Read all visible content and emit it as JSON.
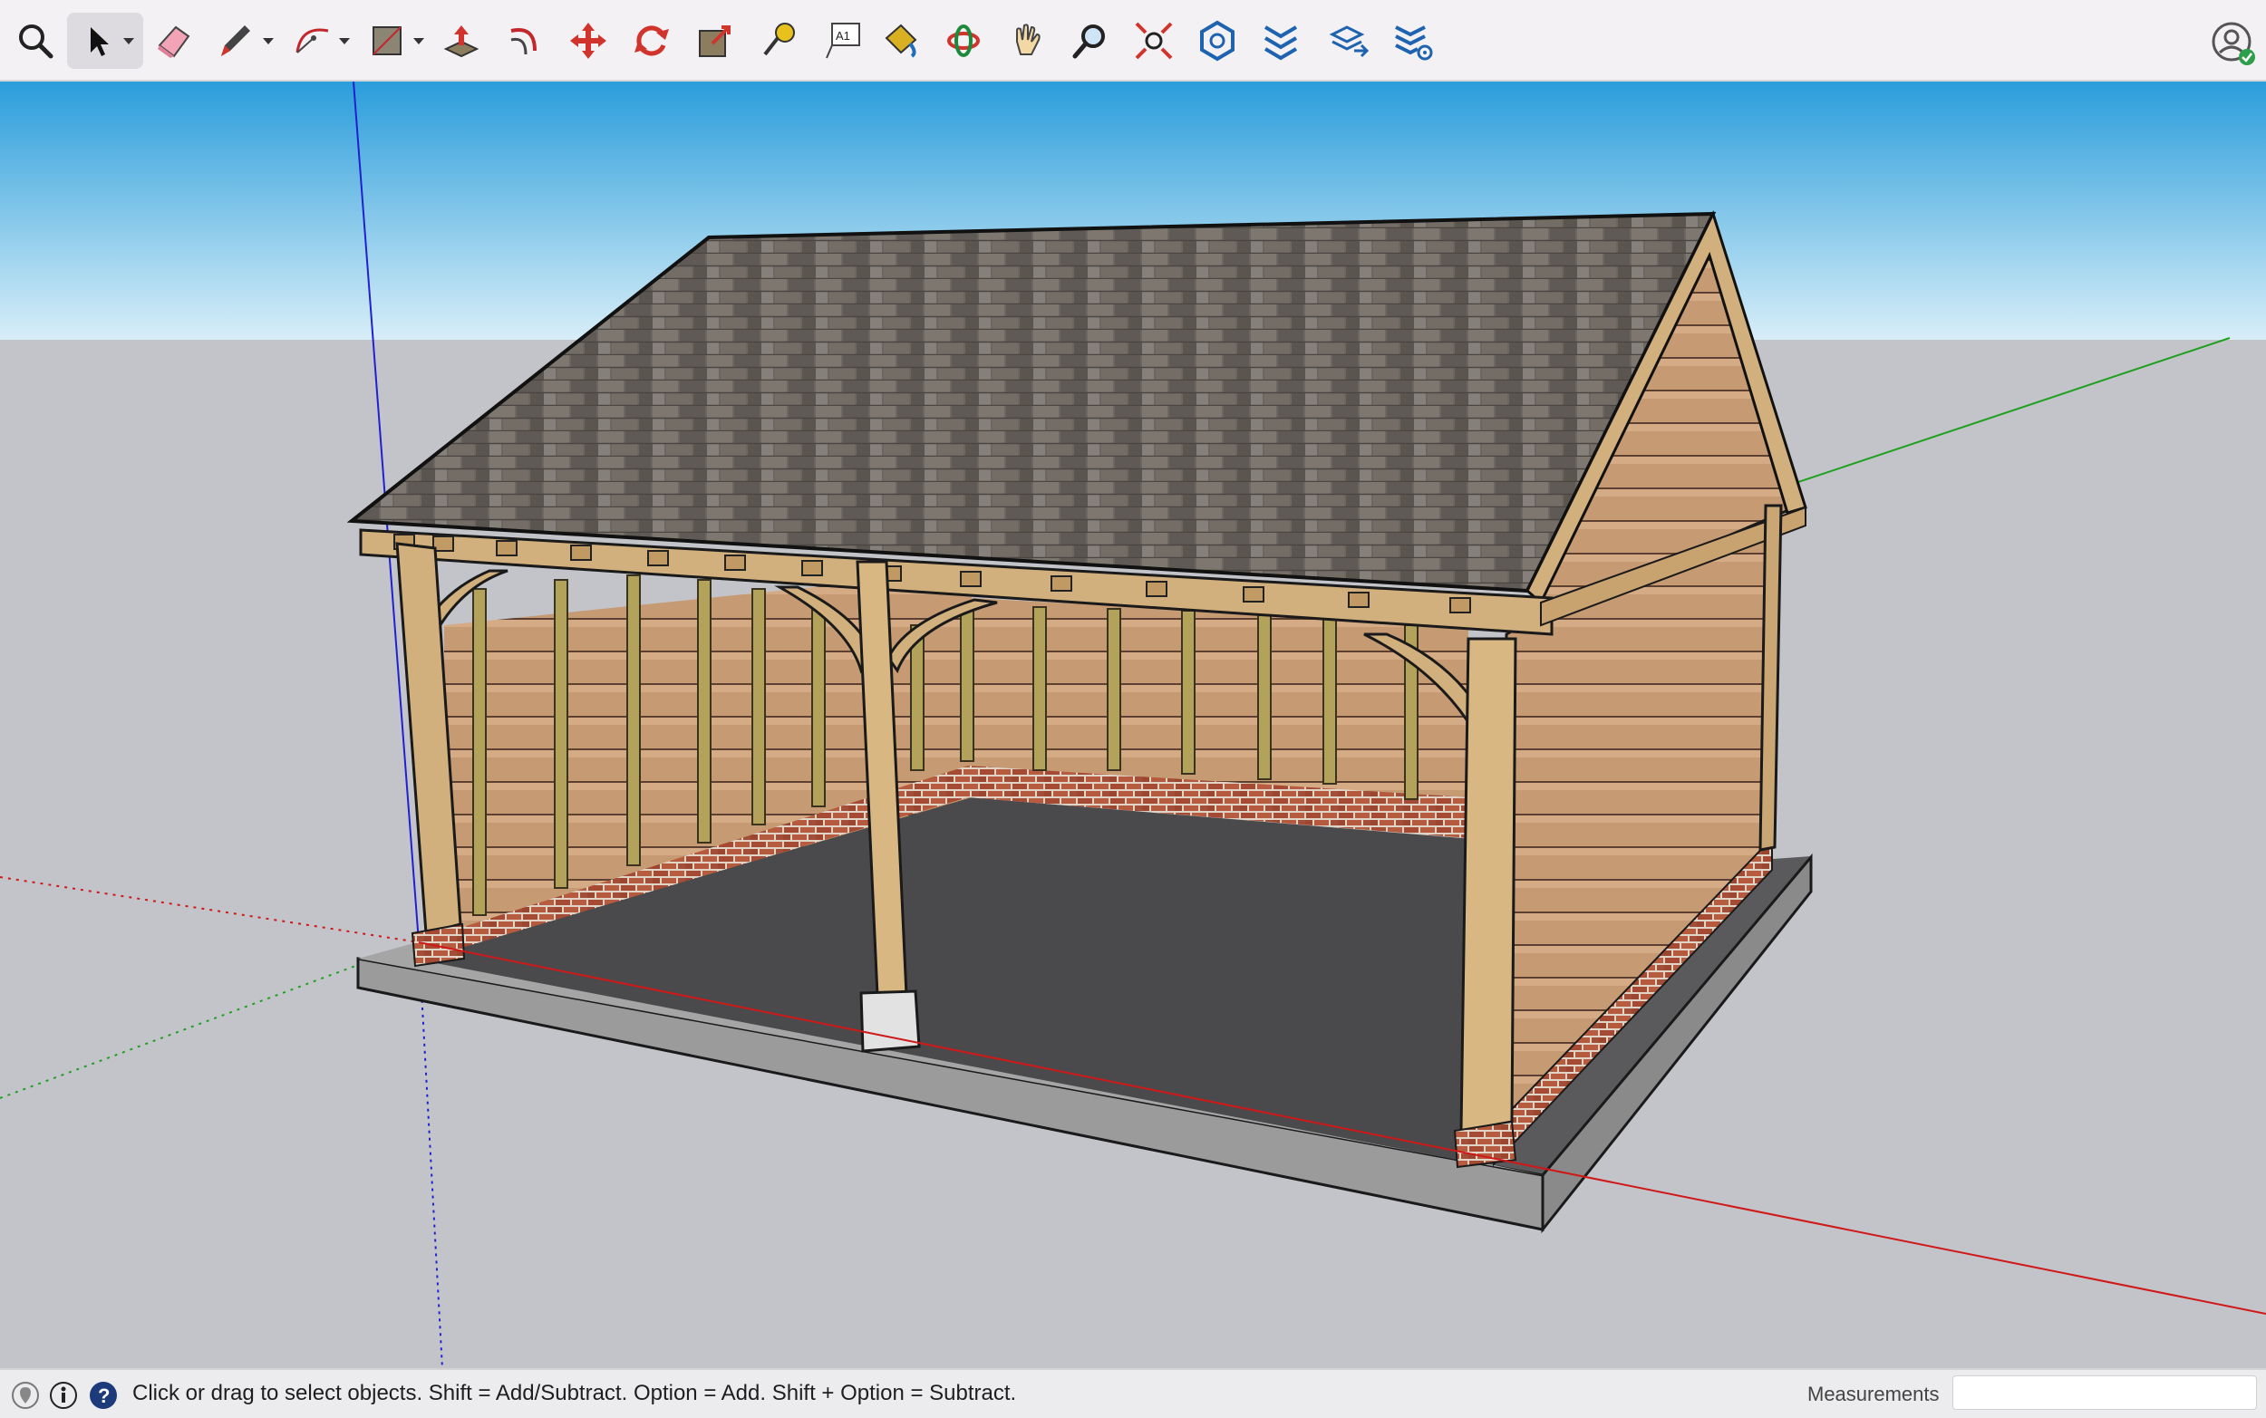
{
  "toolbar": {
    "tools": [
      {
        "name": "zoom-icon",
        "label": "Zoom"
      },
      {
        "name": "select-arrow-icon",
        "label": "Select"
      },
      {
        "name": "eraser-icon",
        "label": "Eraser"
      },
      {
        "name": "pencil-icon",
        "label": "Line"
      },
      {
        "name": "arc-icon",
        "label": "Arc"
      },
      {
        "name": "rectangle-icon",
        "label": "Rectangle"
      },
      {
        "name": "push-pull-icon",
        "label": "Push/Pull"
      },
      {
        "name": "offset-icon",
        "label": "Offset"
      },
      {
        "name": "move-icon",
        "label": "Move"
      },
      {
        "name": "rotate-icon",
        "label": "Rotate"
      },
      {
        "name": "scale-icon",
        "label": "Scale"
      },
      {
        "name": "tape-measure-icon",
        "label": "Tape Measure"
      },
      {
        "name": "text-icon",
        "label": "Text",
        "glyph": "A1"
      },
      {
        "name": "paint-bucket-icon",
        "label": "Paint Bucket"
      },
      {
        "name": "orbit-icon",
        "label": "Orbit"
      },
      {
        "name": "pan-hand-icon",
        "label": "Pan"
      },
      {
        "name": "zoom-window-icon",
        "label": "Zoom"
      },
      {
        "name": "zoom-extents-icon",
        "label": "Zoom Extents"
      },
      {
        "name": "warehouse-icon",
        "label": "3D Warehouse"
      },
      {
        "name": "extension-warehouse-icon",
        "label": "Extension Warehouse"
      },
      {
        "name": "layout-send-icon",
        "label": "Send to LayOut"
      },
      {
        "name": "extension-manager-icon",
        "label": "Extension Manager"
      }
    ]
  },
  "statusbar": {
    "hint": "Click or drag to select objects. Shift = Add/Subtract. Option = Add. Shift + Option = Subtract.",
    "measurements_label": "Measurements",
    "measurements_value": ""
  },
  "colors": {
    "sky_top": "#2a9ddb",
    "sky_bottom": "#d8eef8",
    "ground": "#c3c4c9",
    "red_axis": "#d01818",
    "green_axis": "#20a020",
    "blue_axis": "#2020d0",
    "roof": "#6b6660",
    "oak": "#d2b07e",
    "brick": "#a8503a",
    "floor": "#4a4a4c",
    "slab": "#9b9b9b"
  }
}
